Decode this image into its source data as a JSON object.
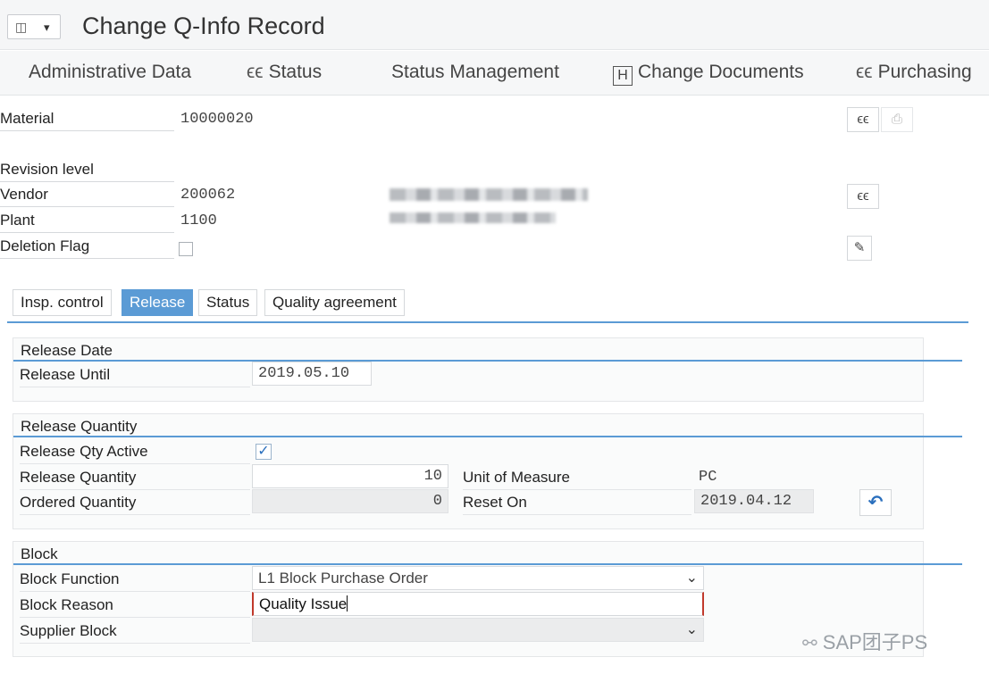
{
  "window": {
    "title": "Change Q-Info Record",
    "menu_caret": "⬇"
  },
  "toolbar": {
    "admin_data": "Administrative Data",
    "status": "Status",
    "status_mgmt": "Status Management",
    "change_docs": "Change Documents",
    "change_docs_icon_letter": "H",
    "purchasing": "Purchasing"
  },
  "header": {
    "material_label": "Material",
    "material_value": "10000020",
    "revision_label": "Revision level",
    "vendor_label": "Vendor",
    "vendor_value": "200062",
    "plant_label": "Plant",
    "plant_value": "1100",
    "deletion_label": "Deletion Flag",
    "deletion_checked": false
  },
  "tabs": [
    {
      "label": "Insp. control",
      "active": false
    },
    {
      "label": "Release",
      "active": true
    },
    {
      "label": "Status",
      "active": false
    },
    {
      "label": "Quality agreement",
      "active": false
    }
  ],
  "release_date": {
    "heading": "Release Date",
    "until_label": "Release Until",
    "until_value": "2019.05.10"
  },
  "release_quantity": {
    "heading": "Release Quantity",
    "active_label": "Release Qty Active",
    "active_checked": true,
    "qty_label": "Release Quantity",
    "qty_value": "10",
    "uom_label": "Unit of Measure",
    "uom_value": "PC",
    "ordered_label": "Ordered Quantity",
    "ordered_value": "0",
    "reset_label": "Reset On",
    "reset_value": "2019.04.12"
  },
  "block": {
    "heading": "Block",
    "function_label": "Block Function",
    "function_value": "L1 Block Purchase Order",
    "reason_label": "Block Reason",
    "reason_value": "Quality Issue",
    "supplier_label": "Supplier Block",
    "supplier_value": ""
  },
  "watermark": "SAP团子PS",
  "colors": {
    "accent": "#5b9bd5",
    "required_marker": "#c0392b"
  },
  "icons": {
    "status": "glasses-icon",
    "change_docs": "history-icon",
    "purchasing": "glasses-icon",
    "display": "glasses-icon",
    "edit": "edit-document-icon",
    "reset": "undo-icon"
  }
}
